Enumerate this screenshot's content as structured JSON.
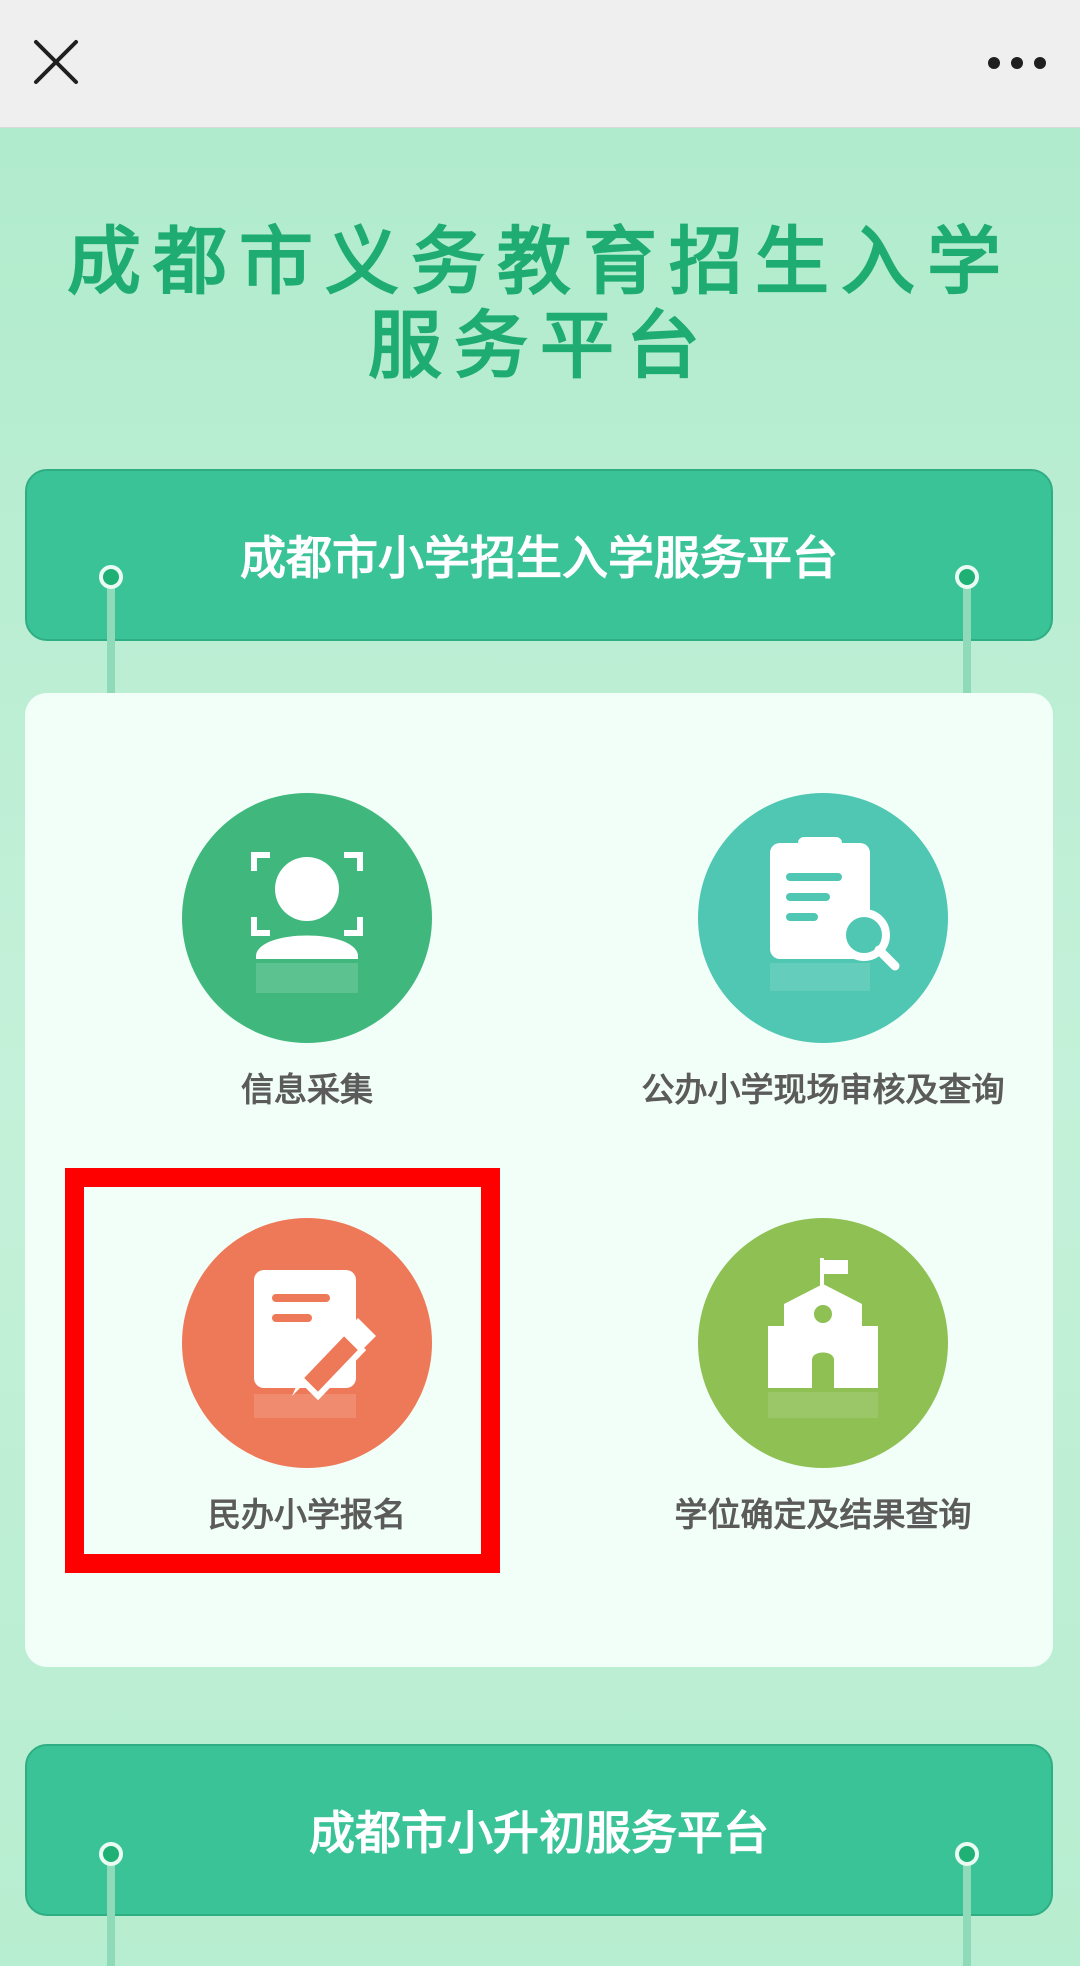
{
  "topbar": {
    "close_icon": "close-icon",
    "more_icon": "more-dots-icon"
  },
  "page": {
    "title": "成都市义务教育招生入学服务平台"
  },
  "banners": {
    "primary": "成都市小学招生入学服务平台",
    "secondary": "成都市小升初服务平台"
  },
  "services": [
    {
      "label": "信息采集",
      "icon": "face-scan-icon",
      "color": "#40b87d"
    },
    {
      "label": "公办小学现场审核及查询",
      "icon": "document-search-icon",
      "color": "#4fc7b2"
    },
    {
      "label": "民办小学报名",
      "icon": "edit-document-icon",
      "color": "#ee7958"
    },
    {
      "label": "学位确定及结果查询",
      "icon": "school-building-icon",
      "color": "#8fc054"
    }
  ],
  "colors": {
    "title": "#1fac73",
    "banner": "#3ac397",
    "highlight": "#ff0000"
  }
}
